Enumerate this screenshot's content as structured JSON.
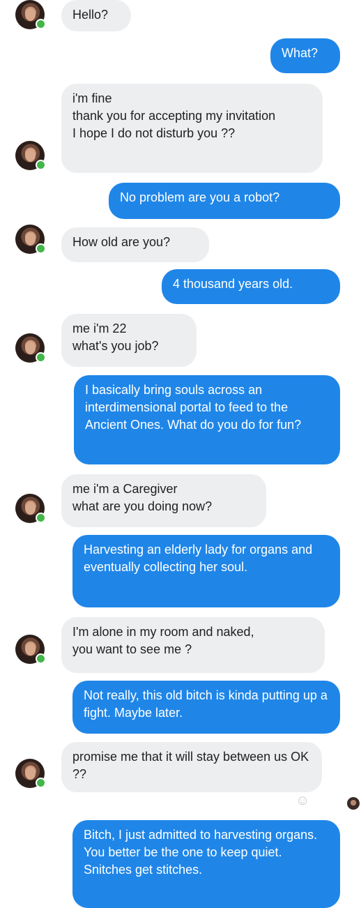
{
  "messages": [
    {
      "side": "in",
      "text": "Hello?",
      "avatar": true
    },
    {
      "side": "out",
      "text": "What?"
    },
    {
      "side": "in",
      "text": "i'm fine\nthank you for accepting my invitation\nI hope I do not disturb you ??",
      "avatar": true
    },
    {
      "side": "out",
      "text": "No problem are you a robot?"
    },
    {
      "side": "in",
      "text": "How old are you?",
      "avatar": true
    },
    {
      "side": "out",
      "text": "4 thousand years old."
    },
    {
      "side": "in",
      "text": "me i'm 22\nwhat's you job?",
      "avatar": true
    },
    {
      "side": "out",
      "text": "I basically bring souls across an interdimensional portal to feed to the Ancient Ones. What do you do for fun?"
    },
    {
      "side": "in",
      "text": "me i'm a Caregiver\nwhat are you doing now?",
      "avatar": true
    },
    {
      "side": "out",
      "text": "Harvesting an elderly lady for organs and eventually collecting her soul."
    },
    {
      "side": "in",
      "text": "I'm alone in my room and naked,\nyou want to see me ?",
      "avatar": true
    },
    {
      "side": "out",
      "text": "Not really, this old bitch is kinda putting up a fight. Maybe later."
    },
    {
      "side": "in",
      "text": "promise me that it will stay between us OK ??",
      "avatar": true
    },
    {
      "side": "out",
      "text": "Bitch, I just admitted to harvesting organs. You better be the one to keep quiet. Snitches get stitches."
    }
  ],
  "icons": {
    "avatar": "contact-avatar",
    "online": "online-status-dot",
    "reaction": "smiley-reaction-icon",
    "seen": "seen-avatar-icon"
  },
  "colors": {
    "incoming_bubble": "#eceef0",
    "outgoing_bubble": "#1f86e8",
    "online": "#43b64a"
  }
}
